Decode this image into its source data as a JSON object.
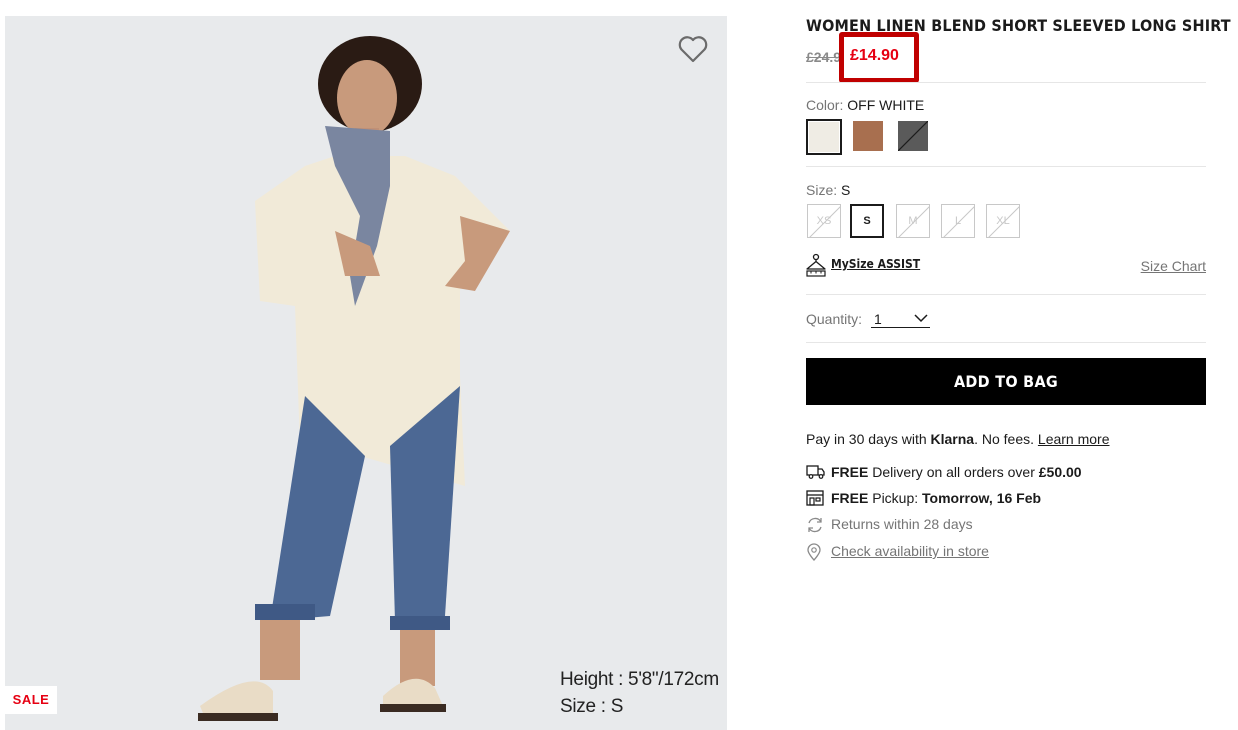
{
  "product": {
    "title": "WOMEN LINEN BLEND SHORT SLEEVED LONG SHIRT",
    "price_original": "£24.90",
    "price_sale": "£14.90"
  },
  "gallery": {
    "model_height": "Height : 5'8\"/172cm",
    "model_size": "Size : S",
    "badge": "SALE",
    "favorite_icon": "heart-outline-icon"
  },
  "color": {
    "label": "Color:",
    "selected": "OFF WHITE",
    "swatches": [
      {
        "name": "off-white",
        "hex": "#efece4",
        "selected": true
      },
      {
        "name": "brown",
        "hex": "#a86f4f",
        "selected": false
      },
      {
        "name": "dark-gray",
        "hex": "#5a5a5a",
        "selected": false,
        "unavailable": true
      }
    ]
  },
  "size": {
    "label": "Size:",
    "selected": "S",
    "options": [
      {
        "label": "XS",
        "available": false,
        "selected": false
      },
      {
        "label": "S",
        "available": true,
        "selected": true
      },
      {
        "label": "M",
        "available": false,
        "selected": false
      },
      {
        "label": "L",
        "available": false,
        "selected": false
      },
      {
        "label": "XL",
        "available": false,
        "selected": false
      }
    ],
    "mysize_label": "MySize ASSIST",
    "size_chart_label": "Size Chart"
  },
  "quantity": {
    "label": "Quantity:",
    "value": "1"
  },
  "cta": {
    "add_to_bag": "ADD TO BAG"
  },
  "klarna": {
    "prefix": "Pay in 30 days with ",
    "brand": "Klarna",
    "suffix": ". No fees. ",
    "link": "Learn more"
  },
  "perks": {
    "delivery": {
      "bold": "FREE",
      "text": " Delivery on all orders over ",
      "amount": "£50.00",
      "icon": "truck-icon"
    },
    "pickup": {
      "bold": "FREE",
      "text": " Pickup: ",
      "when": "Tomorrow, 16 Feb",
      "icon": "store-icon"
    },
    "returns": {
      "text": "Returns within 28 days",
      "icon": "returns-icon"
    },
    "availability": {
      "text": "Check availability in store",
      "icon": "location-pin-icon"
    }
  },
  "colors": {
    "sale_red": "#e60012",
    "highlight_red": "#c00000",
    "cta_black": "#000000"
  }
}
